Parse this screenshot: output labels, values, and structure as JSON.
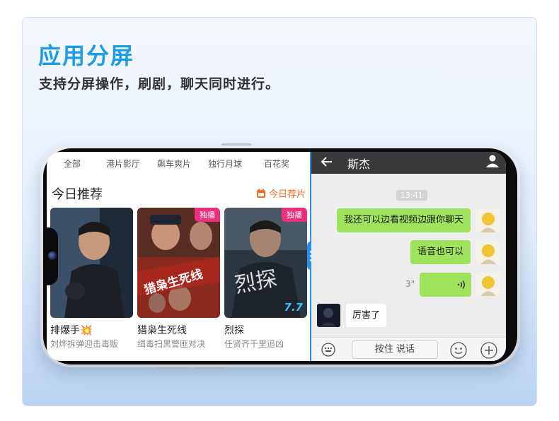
{
  "header": {
    "title": "应用分屏",
    "subtitle": "支持分屏操作，刷剧，聊天同时进行。"
  },
  "video_app": {
    "categories": [
      "全部",
      "港片影厅",
      "飙车爽片",
      "独行月球",
      "百花奖"
    ],
    "section_title": "今日推荐",
    "today_tag": "今日荐片",
    "movies": [
      {
        "title": "排爆手💥",
        "desc": "刘烨拆弹迎击毒贩",
        "badge": "",
        "rating": ""
      },
      {
        "title": "猎枭生死线",
        "desc": "缉毒扫黑警匪对决",
        "badge": "独播",
        "rating": "",
        "poster_text": "猎枭生死线"
      },
      {
        "title": "烈探",
        "desc": "任贤齐千里追凶",
        "badge": "独播",
        "rating": "7.7",
        "poster_text": "烈探"
      }
    ]
  },
  "chat_app": {
    "contact_name": "斯杰",
    "timestamp": "13:41",
    "messages": [
      {
        "from": "me",
        "type": "text",
        "text": "我还可以边看视频边跟你聊天"
      },
      {
        "from": "me",
        "type": "text",
        "text": "语音也可以"
      },
      {
        "from": "me",
        "type": "voice",
        "duration": "3\""
      },
      {
        "from": "other",
        "type": "text",
        "text": "厉害了"
      }
    ],
    "hold_to_talk": "按住 说话"
  },
  "colors": {
    "title_blue": "#1e9be5",
    "divider_blue": "#2a8fe8",
    "bubble_green": "#9ee35b",
    "badge_pink": "#ec2f7c",
    "today_orange": "#ff6a1a"
  }
}
